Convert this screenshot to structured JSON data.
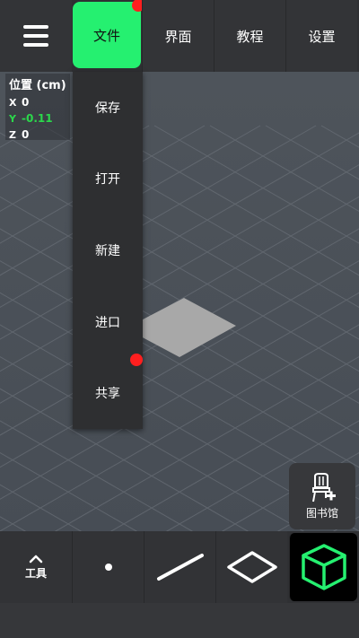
{
  "top_tabs": [
    {
      "label": "文件"
    },
    {
      "label": "界面"
    },
    {
      "label": "教程"
    },
    {
      "label": "设置"
    }
  ],
  "file_menu": [
    {
      "label": "保存"
    },
    {
      "label": "打开"
    },
    {
      "label": "新建"
    },
    {
      "label": "进口"
    },
    {
      "label": "共享"
    }
  ],
  "position_panel": {
    "title": "位置 (cm)",
    "x_axis": "X",
    "x_value": "0",
    "y_axis": "Y",
    "y_value": "-0.11",
    "z_axis": "Z",
    "z_value": "0"
  },
  "library": {
    "label": "图书馆",
    "icon": "chair-plus-icon"
  },
  "toolbar": {
    "tools_label": "工具",
    "tools_icon": "chevron-up-icon",
    "point_icon": "point-icon",
    "line_icon": "line-icon",
    "plane_icon": "plane-icon",
    "cube_icon": "cube-icon"
  },
  "colors": {
    "accent": "#25f070",
    "notification": "#ff1f1f",
    "y_axis": "#2bd84b"
  }
}
